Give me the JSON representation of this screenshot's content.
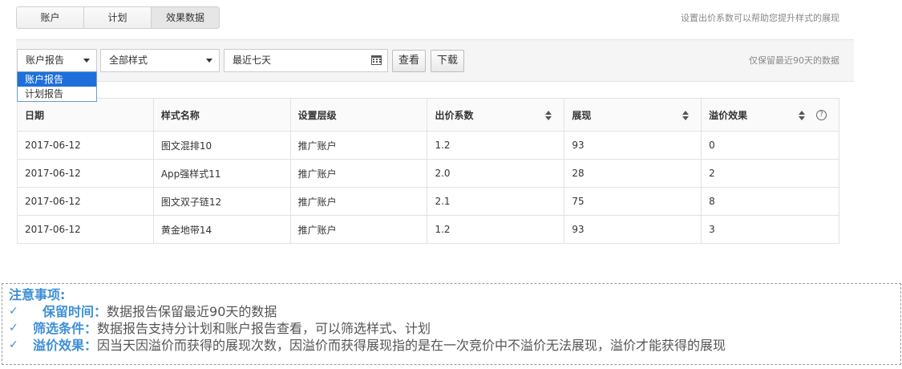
{
  "tabs": [
    {
      "label": "账户"
    },
    {
      "label": "计划"
    },
    {
      "label": "效果数据"
    }
  ],
  "top_hint": "设置出价系数可以帮助您提升样式的展现",
  "filters": {
    "report_type": "账户报告",
    "style": "全部样式",
    "date_range": "最近七天",
    "view_button": "查看",
    "download_button": "下载",
    "hint": "仅保留最近90天的数据"
  },
  "dropdown": {
    "options": [
      {
        "label": "账户报告",
        "highlighted": true
      },
      {
        "label": "计划报告",
        "highlighted": false
      }
    ]
  },
  "table": {
    "headers": [
      "日期",
      "样式名称",
      "设置层级",
      "出价系数",
      "展现",
      "溢价效果"
    ],
    "sortable": [
      false,
      false,
      false,
      true,
      true,
      true
    ],
    "help_icon": "?",
    "rows": [
      [
        "2017-06-12",
        "图文混排10",
        "推广账户",
        "1.2",
        "93",
        "0"
      ],
      [
        "2017-06-12",
        "App强样式11",
        "推广账户",
        "2.0",
        "28",
        "2"
      ],
      [
        "2017-06-12",
        "图文双子链12",
        "推广账户",
        "2.1",
        "75",
        "8"
      ],
      [
        "2017-06-12",
        "黄金地带14",
        "推广账户",
        "1.2",
        "93",
        "3"
      ]
    ]
  },
  "notes": {
    "title": "注意事项:",
    "check_glyph": "✓",
    "items": [
      {
        "key": "保留时间：",
        "text": "数据报告保留最近90天的数据"
      },
      {
        "key": "筛选条件：",
        "text": "数据报告支持分计划和账户报告查看，可以筛选样式、计划"
      },
      {
        "key": "溢价效果：",
        "text": "因当天因溢价而获得的展现次数，因溢价而获得展现指的是在一次竞价中不溢价无法展现，溢价才能获得的展现"
      }
    ]
  },
  "colors": {
    "accent": "#3d8fd6",
    "dropdown_highlight": "#1e6fd9",
    "border": "#e2e2e2"
  }
}
